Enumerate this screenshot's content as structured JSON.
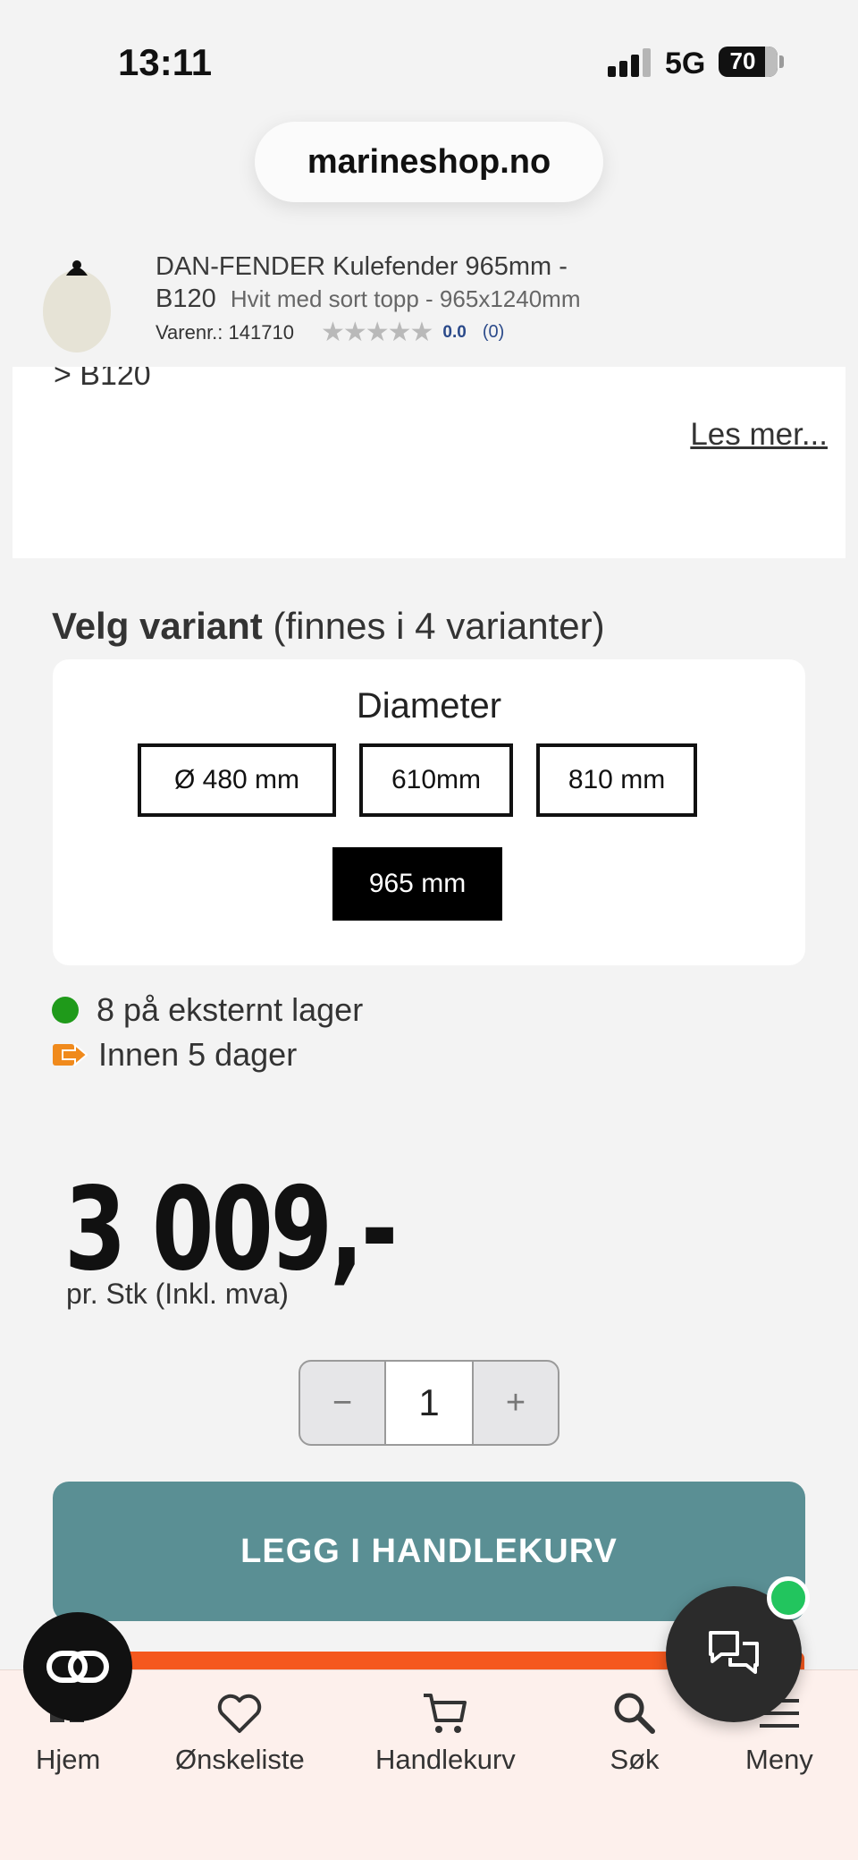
{
  "status_bar": {
    "time": "13:11",
    "network": "5G",
    "battery": "70"
  },
  "browser": {
    "url": "marineshop.no"
  },
  "product": {
    "title_line1": "DAN-FENDER Kulefender 965mm -",
    "title_line2_main": "B120",
    "title_line2_sub": "Hvit med sort topp - 965x1240mm",
    "sku_label": "Varenr.: 141710",
    "stars": "★★★★★",
    "rating": "0.0",
    "rating_count": "(0)"
  },
  "description": {
    "partial_text": "> B120",
    "read_more": "Les mer..."
  },
  "variants": {
    "title_bold": "Velg variant",
    "title_rest": " (finnes i 4 varianter)",
    "diameter_label": "Diameter",
    "options": [
      "Ø 480 mm",
      "610mm",
      "810 mm",
      "965 mm"
    ],
    "selected": "965 mm"
  },
  "stock": {
    "availability": "8 på eksternt lager",
    "delivery": "Innen 5 dager"
  },
  "price": {
    "amount": "3 009,-",
    "note": "pr. Stk (Inkl. mva)"
  },
  "quantity": {
    "minus": "−",
    "value": "1",
    "plus": "+"
  },
  "cart_button": {
    "label": "LEGG I HANDLEKURV"
  },
  "nav": {
    "home": "Hjem",
    "wishlist": "Ønskeliste",
    "cart": "Handlekurv",
    "search": "Søk",
    "menu": "Meny"
  },
  "colors": {
    "teal": "#5a8f94",
    "orange": "#f5581e",
    "green": "#1f9a1a",
    "chat_badge": "#22c55e"
  }
}
